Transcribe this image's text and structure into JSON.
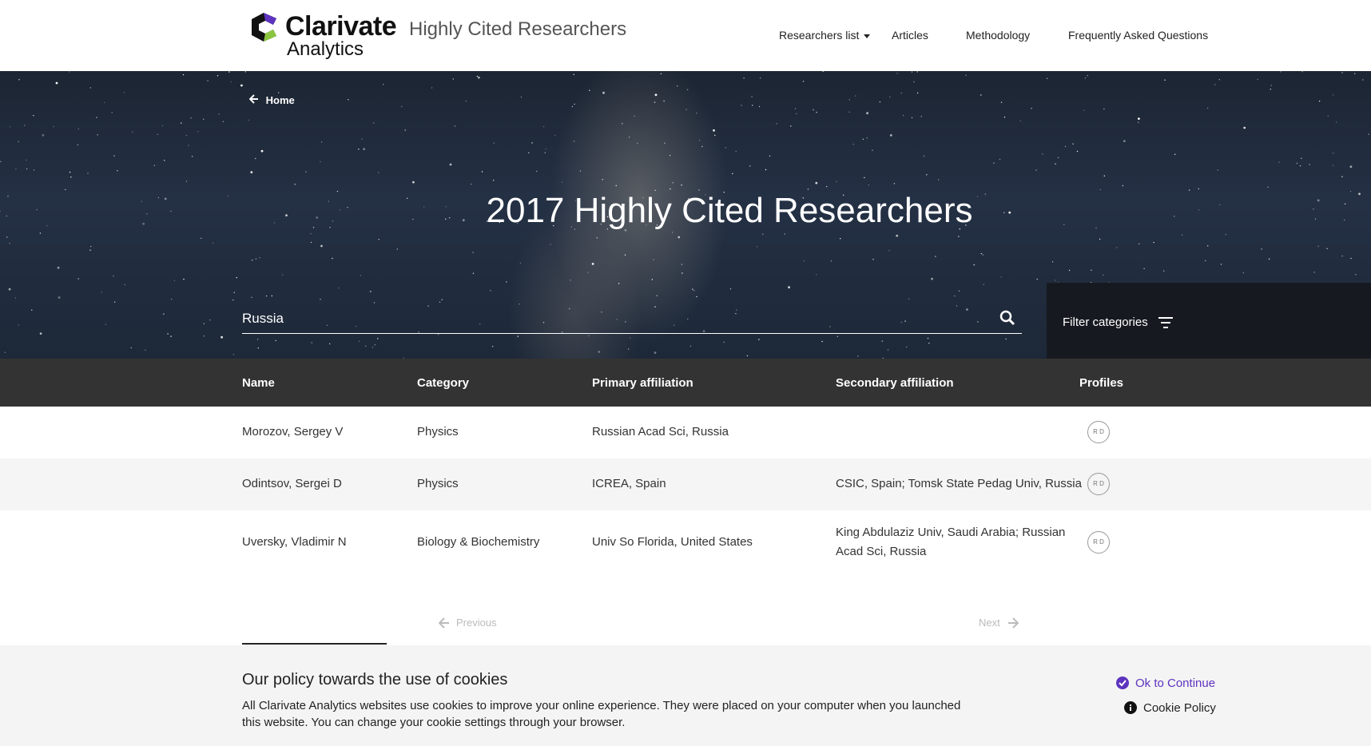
{
  "header": {
    "logo_name": "Clarivate",
    "logo_sub": "Analytics",
    "site_title": "Highly Cited Researchers",
    "nav": {
      "researchers_list": "Researchers list",
      "articles": "Articles",
      "methodology": "Methodology",
      "faq": "Frequently Asked Questions"
    }
  },
  "hero": {
    "home_link": "Home",
    "title": "2017 Highly Cited Researchers",
    "search_value": "Russia",
    "filter_label": "Filter categories"
  },
  "table": {
    "headers": {
      "name": "Name",
      "category": "Category",
      "primary": "Primary affiliation",
      "secondary": "Secondary affiliation",
      "profiles": "Profiles"
    },
    "rows": [
      {
        "name": "Morozov, Sergey V",
        "category": "Physics",
        "primary": "Russian Acad Sci, Russia",
        "secondary": "",
        "profile": "R D"
      },
      {
        "name": "Odintsov, Sergei D",
        "category": "Physics",
        "primary": "ICREA, Spain",
        "secondary": "CSIC, Spain; Tomsk State Pedag Univ, Russia",
        "profile": "R D"
      },
      {
        "name": "Uversky, Vladimir N",
        "category": "Biology & Biochemistry",
        "primary": "Univ So Florida, United States",
        "secondary_line1": "King Abdulaziz Univ, Saudi Arabia; Russian",
        "secondary_line2": "Acad Sci, Russia",
        "profile": "R D"
      }
    ]
  },
  "pagination": {
    "previous": "Previous",
    "next": "Next"
  },
  "cookie": {
    "title": "Our policy towards the use of cookies",
    "text": "All Clarivate Analytics websites use cookies to improve your online experience. They were placed on your computer when you launched this website. You can change your cookie settings through your browser.",
    "ok": "Ok to Continue",
    "policy": "Cookie Policy"
  },
  "colors": {
    "accent_purple": "#5e33bf",
    "table_header": "#333333",
    "logo_green": "#8bc53f"
  }
}
